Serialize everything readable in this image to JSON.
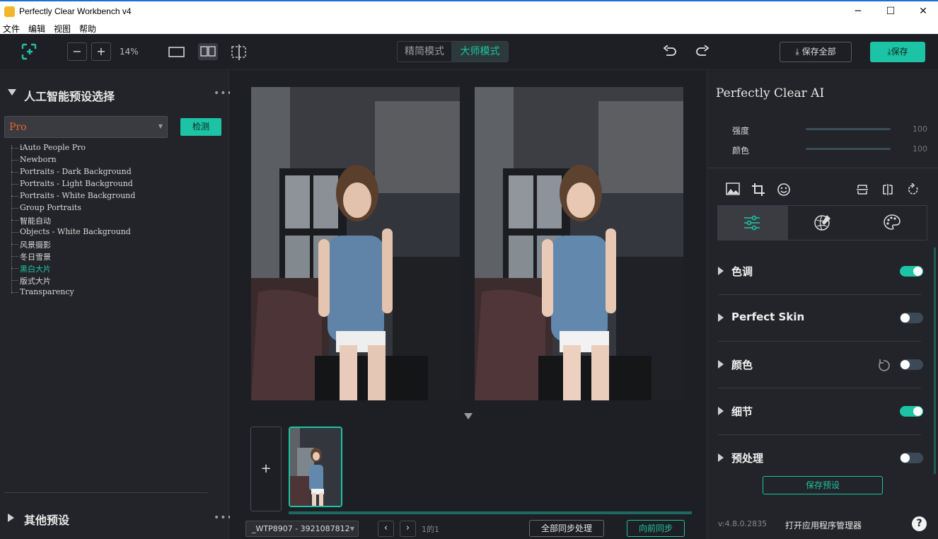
{
  "window": {
    "title": "Perfectly Clear Workbench v4",
    "min": "─",
    "max": "☐",
    "close": "✕"
  },
  "menu": [
    "文件",
    "编辑",
    "视图",
    "帮助"
  ],
  "toolbar": {
    "zoom": "14%",
    "zoom_out": "−",
    "zoom_in": "+",
    "mode_simple": "精简模式",
    "mode_master": "大师模式",
    "save_all": "保存全部",
    "save": "保存"
  },
  "left": {
    "title": "人工智能预设选择",
    "more": "•••",
    "select_value": "Pro",
    "detect": "检测",
    "presets": [
      "iAuto People Pro",
      "Newborn",
      "Portraits - Dark Background",
      "Portraits - Light Background",
      "Portraits - White Background",
      "Group Portraits",
      "智能自动",
      "Objects - White Background",
      "风景摄影",
      "冬日雪景",
      "黑白大片",
      "版式大片",
      "Transparency"
    ],
    "active_index": 10,
    "other_title": "其他预设"
  },
  "center": {
    "add": "+",
    "file": "_WTP8907 - 3921087812",
    "page": "1的1",
    "sync_all": "全部同步处理",
    "sync_fwd": "向前同步"
  },
  "right": {
    "title": "Perfectly Clear AI",
    "strength_label": "强度",
    "strength_value": "100",
    "color_label": "颜色",
    "color_value": "100",
    "sections": [
      {
        "name": "色调",
        "on": true
      },
      {
        "name": "Perfect Skin",
        "on": false
      },
      {
        "name": "颜色",
        "on": false
      },
      {
        "name": "细节",
        "on": true
      },
      {
        "name": "预处理",
        "on": false
      }
    ],
    "save_preset": "保存预设",
    "version": "v:4.8.0.2835",
    "open_manager": "打开应用程序管理器",
    "help": "?"
  },
  "colors": {
    "accent": "#1cc3a4",
    "bg": "#1e1f24",
    "panel": "#232429"
  }
}
